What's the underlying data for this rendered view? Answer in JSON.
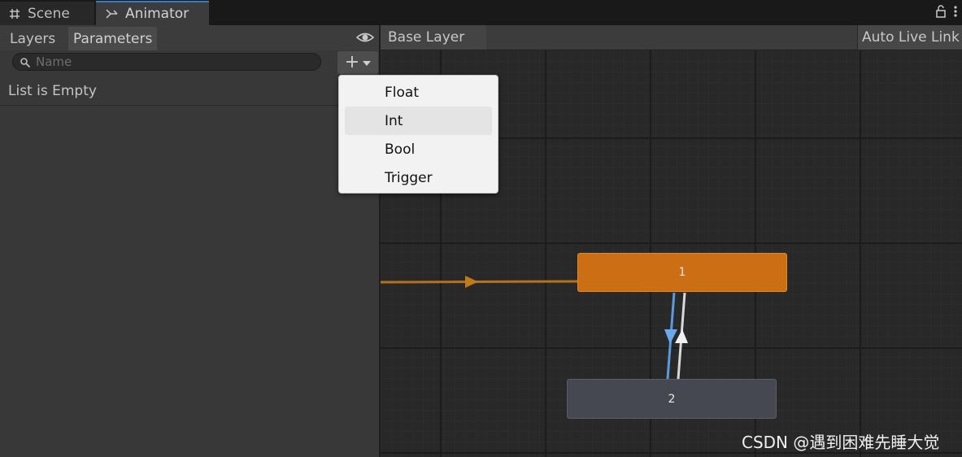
{
  "window": {
    "tabs": [
      {
        "label": "Scene",
        "icon": "grid-icon"
      },
      {
        "label": "Animator",
        "icon": "animator-icon",
        "active": true
      }
    ],
    "icons": [
      "lock-icon",
      "more-vertical-icon"
    ]
  },
  "left_panel": {
    "tabs": [
      {
        "label": "Layers"
      },
      {
        "label": "Parameters",
        "active": true
      }
    ],
    "search": {
      "placeholder": "Name",
      "value": ""
    },
    "empty_text": "List is Empty",
    "add_button": {
      "label": "+"
    }
  },
  "graph": {
    "breadcrumb": "Base Layer",
    "auto_live_link": "Auto Live Link",
    "states": [
      {
        "label": "1",
        "color": "#cc6e14",
        "default": true
      },
      {
        "label": "2",
        "color": "#454850"
      }
    ],
    "colors": {
      "entry_transition": "#b5721a",
      "selected_transition": "#5c9ae0",
      "transition": "#d8d8d8"
    }
  },
  "dropdown_menu": {
    "items": [
      {
        "label": "Float"
      },
      {
        "label": "Int",
        "highlighted": true
      },
      {
        "label": "Bool"
      },
      {
        "label": "Trigger"
      }
    ]
  },
  "watermark": "CSDN @遇到困难先睡大觉"
}
